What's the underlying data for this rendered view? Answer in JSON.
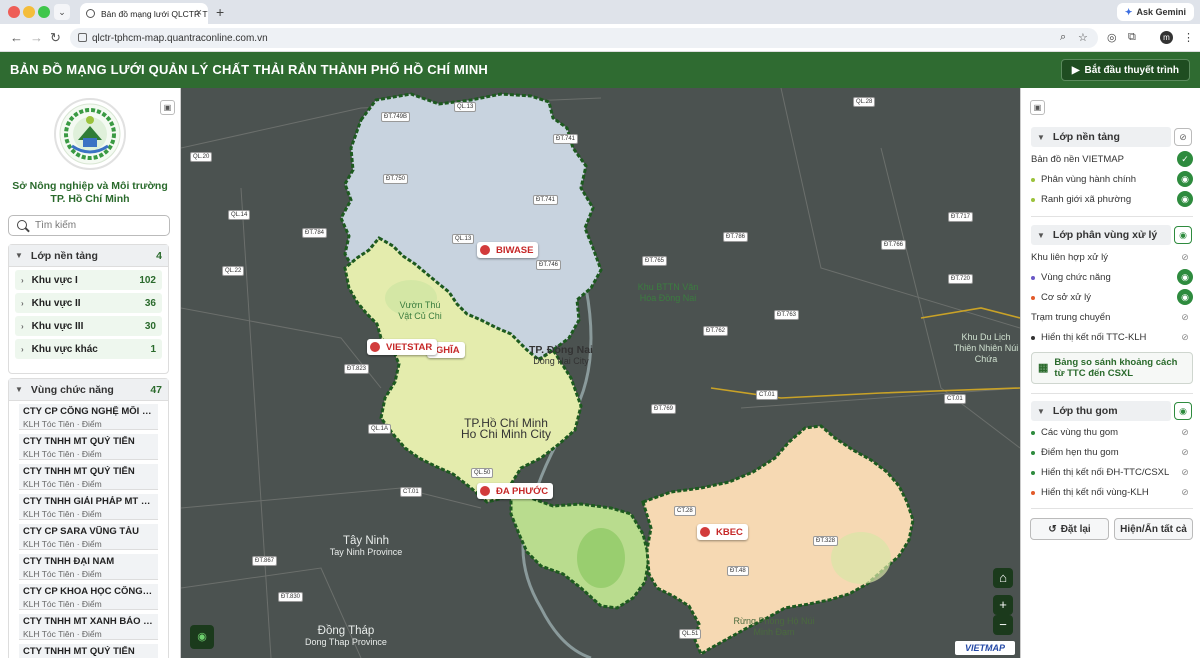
{
  "browser": {
    "tab_title": "Bản đồ mạng lưới QLCTR TP.HCM",
    "url": "qlctr-tphcm-map.quantraconline.com.vn",
    "gemini_label": "Ask Gemini",
    "new_tab": "+",
    "tab_close": "×"
  },
  "header": {
    "title": "BẢN ĐỒ MẠNG LƯỚI QUẢN LÝ CHẤT THẢI RẮN THÀNH PHỐ HỒ CHÍ MINH",
    "tour_button": "Bắt đầu thuyết trình"
  },
  "left": {
    "org_line1": "Sở Nông nghiệp và Môi trường",
    "org_line2": "TP. Hồ Chí Minh",
    "search_placeholder": "Tìm kiếm",
    "group1": {
      "title": "Lớp nền tảng",
      "count": "4",
      "items": [
        {
          "label": "Khu vực I",
          "count": "102"
        },
        {
          "label": "Khu vực II",
          "count": "36"
        },
        {
          "label": "Khu vực III",
          "count": "30"
        },
        {
          "label": "Khu vực khác",
          "count": "1"
        }
      ]
    },
    "group2": {
      "title": "Vùng chức năng",
      "count": "47",
      "items": [
        {
          "name": "CTY CP CÔNG NGHỆ MÔI TRƯ...",
          "sub": "KLH Tóc Tiên · Điểm"
        },
        {
          "name": "CTY TNHH MT QUÝ TIẾN",
          "sub": "KLH Tóc Tiên · Điểm"
        },
        {
          "name": "CTY TNHH MT QUÝ TIẾN",
          "sub": "KLH Tóc Tiên · Điểm"
        },
        {
          "name": "CTY TNHH GIẢI PHÁP MT NHẬ...",
          "sub": "KLH Tóc Tiên · Điểm"
        },
        {
          "name": "CTY CP SARA VŨNG TÀU",
          "sub": "KLH Tóc Tiên · Điểm"
        },
        {
          "name": "CTY TNHH ĐẠI NAM",
          "sub": "KLH Tóc Tiên · Điểm"
        },
        {
          "name": "CTY CP KHOA HỌC CÔNG NG...",
          "sub": "KLH Tóc Tiên · Điểm"
        },
        {
          "name": "CTY TNHH MT XANH BẢO NG...",
          "sub": "KLH Tóc Tiên · Điểm"
        },
        {
          "name": "CTY TNHH MT QUÝ TIẾN",
          "sub": ""
        }
      ]
    }
  },
  "map": {
    "markers": [
      "BIWASE",
      "VIETSTAR",
      "NGHĨA",
      "ĐA PHƯỚC",
      "KBEC"
    ],
    "places": {
      "hcm_vi": "TP.Hồ Chí Minh",
      "hcm_en": "Ho Chi Minh City",
      "dongnai_vi": "TP. Đồng Nai",
      "dongnai_en": "Dong Nai City",
      "tayninh_vi": "Tây Ninh",
      "tayninh_en": "Tay Ninh Province",
      "dongthap_vi": "Đồng Tháp",
      "dongthap_en": "Dong Thap Province",
      "vuon_thu": "Vườn Thú Vật Củ Chi",
      "khu_bttn": "Khu BTTN Văn Hóa Đồng Nai",
      "khu_du_lich": "Khu Du Lịch Thiên Nhiên Núi Chứa",
      "rung_phong_ho": "Rừng Phòng Hộ Núi Minh Đạm"
    },
    "roads": [
      "ĐT.749B",
      "QL.13",
      "ĐT.741",
      "QL.20",
      "ĐT.750",
      "ĐT.741",
      "QL.14",
      "QL.13",
      "ĐT.746",
      "ĐT.784",
      "QL.28",
      "ĐT.766",
      "ĐT.786",
      "QL.22",
      "ĐT.765",
      "ĐT.720",
      "ĐT.717",
      "ĐT.762",
      "ĐT.763",
      "ĐT.823",
      "CT.01",
      "ĐT.769",
      "CT.01",
      "QL.1A",
      "CT.01",
      "QL.50",
      "CT.28",
      "ĐT.328",
      "ĐT.48",
      "QL.51",
      "ĐT.867",
      "ĐT.830"
    ],
    "vietmap_logo": "VIETMAP",
    "zoom_in": "+",
    "zoom_out": "−"
  },
  "right": {
    "sections": [
      {
        "title": "Lớp nền tảng"
      },
      {
        "title": "Lớp phân vùng xử lý"
      },
      {
        "title": "Lớp thu gom"
      }
    ],
    "rows": [
      {
        "label": "Bản đồ nền VIETMAP",
        "color": ""
      },
      {
        "label": "Phân vùng hành chính",
        "color": "#9bc23c"
      },
      {
        "label": "Ranh giới xã phường",
        "color": "#9bc23c"
      },
      {
        "label": "Khu liên hợp xử lý",
        "color": ""
      },
      {
        "label": "Vùng chức năng",
        "color": "#6a58c6"
      },
      {
        "label": "Cơ sở xử lý",
        "color": "#e25b2b"
      },
      {
        "label": "Trạm trung chuyển",
        "color": ""
      },
      {
        "label": "Hiển thị kết nối TTC-KLH",
        "color": "#333"
      },
      {
        "label": "Các vùng thu gom",
        "color": "#2e8b3e"
      },
      {
        "label": "Điểm hẹn thu gom",
        "color": "#2e8b3e"
      },
      {
        "label": "Hiển thị kết nối ĐH-TTC/CSXL",
        "color": "#2e8b3e"
      },
      {
        "label": "Hiển thị kết nối vùng-KLH",
        "color": "#e25b2b"
      }
    ],
    "compare_button": "Bảng so sánh khoảng cách từ TTC đến CSXL",
    "reset_button": "Đặt lại",
    "toggle_all_button": "Hiện/Ẩn tất cả"
  }
}
